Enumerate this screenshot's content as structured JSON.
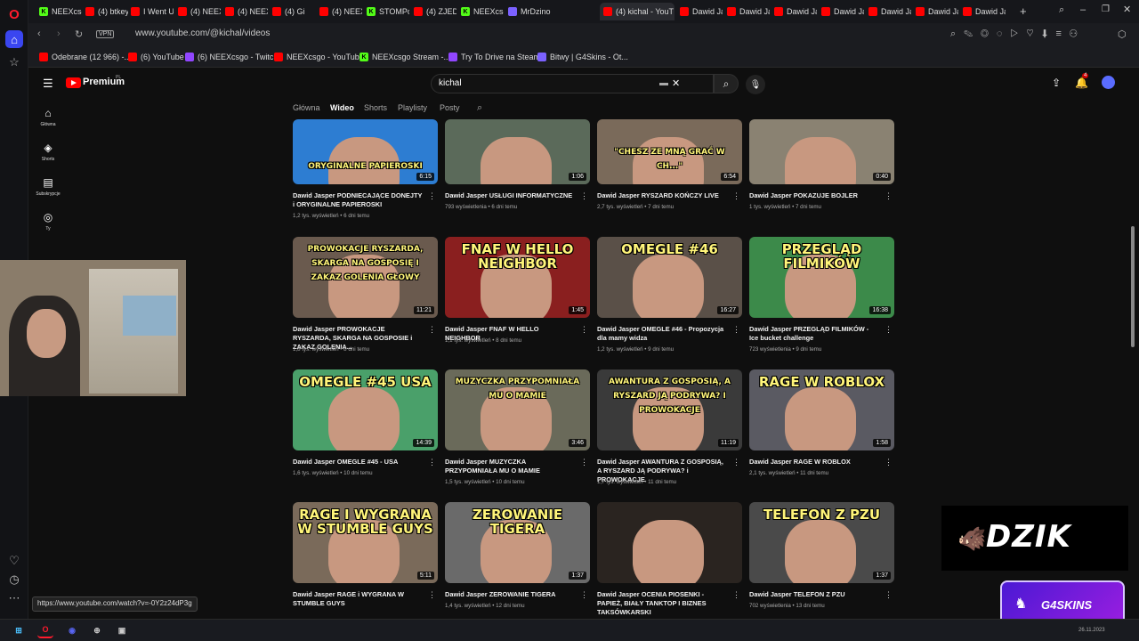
{
  "browser": {
    "tabs": [
      {
        "label": "NEEXcsgo",
        "fav": "k"
      },
      {
        "label": "(4) btkey",
        "fav": "yt"
      },
      {
        "label": "I Went U",
        "fav": "yt"
      },
      {
        "label": "(4) NEEX",
        "fav": "yt"
      },
      {
        "label": "(4) NEEX",
        "fav": "yt"
      },
      {
        "label": "(4) Gi",
        "fav": "yt"
      },
      {
        "label": "(4) NEEX",
        "fav": "yt"
      },
      {
        "label": "STOMPcs",
        "fav": "k"
      },
      {
        "label": "(4) ZJEDL",
        "fav": "yt"
      },
      {
        "label": "NEEXcsgo",
        "fav": "k"
      },
      {
        "label": "MrDzinol",
        "fav": "ms"
      },
      {
        "label": "(4) kichal - YouT",
        "fav": "yt"
      },
      {
        "label": "Dawid Ja",
        "fav": "yt"
      },
      {
        "label": "Dawid Ja",
        "fav": "yt"
      },
      {
        "label": "Dawid Ja",
        "fav": "yt"
      },
      {
        "label": "Dawid Ja",
        "fav": "yt"
      },
      {
        "label": "Dawid Ja",
        "fav": "yt"
      },
      {
        "label": "Dawid Ja",
        "fav": "yt"
      },
      {
        "label": "Dawid Ja",
        "fav": "yt"
      }
    ],
    "vpn_label": "VPN",
    "url": "www.youtube.com/@kichal/videos",
    "bookmarks": [
      {
        "label": "Odebrane (12 966) -...",
        "fav": "yt"
      },
      {
        "label": "(6) YouTube",
        "fav": "yt"
      },
      {
        "label": "(6) NEEXcsgo - Twitch",
        "fav": "tw"
      },
      {
        "label": "NEEXcsgo - YouTube",
        "fav": "yt"
      },
      {
        "label": "NEEXcsgo Stream -...",
        "fav": "k"
      },
      {
        "label": "Try To Drive na Steam",
        "fav": "tw"
      },
      {
        "label": "Bitwy | G4Skins - Ot...",
        "fav": "ms"
      }
    ]
  },
  "youtube": {
    "logo": "Premium",
    "logo_region": "PL",
    "search_value": "kichal",
    "notif_count": "4",
    "guide": [
      {
        "label": "Główna",
        "icon": "home-icon"
      },
      {
        "label": "Shorts",
        "icon": "shorts-icon"
      },
      {
        "label": "Subskrypcje",
        "icon": "subscriptions-icon"
      },
      {
        "label": "Ty",
        "icon": "you-icon"
      }
    ],
    "channel_tabs": [
      "Główna",
      "Wideo",
      "Shorts",
      "Playlisty",
      "Posty"
    ],
    "videos": [
      {
        "thumb_text": "ORYGINALNE PAPIEROSKI",
        "title": "Dawid Jasper PODNIECAJĄCE DONEJTY i ORYGINALNE PAPIEROSKI",
        "meta": "1,2 tys. wyświetleń • 6 dni temu",
        "duration": "6:15",
        "bg": "#2d7dd2"
      },
      {
        "thumb_text": "",
        "title": "Dawid Jasper USŁUGI INFORMATYCZNE",
        "meta": "793 wyświetlenia • 6 dni temu",
        "duration": "1:06",
        "bg": "#5b6a5a"
      },
      {
        "thumb_text": "\"CHESZ ZE MNĄ GRAĆ W CH...\"",
        "title": "Dawid Jasper RYSZARD KOŃCZY LIVE",
        "meta": "2,7 tys. wyświetleń • 7 dni temu",
        "duration": "6:54",
        "bg": "#7a6a5a"
      },
      {
        "thumb_text": "",
        "title": "Dawid Jasper POKAZUJE BOJLER",
        "meta": "1 tys. wyświetleń • 7 dni temu",
        "duration": "0:40",
        "bg": "#8a8272"
      },
      {
        "thumb_text": "PROWOKACJE RYSZARDA, SKARGA NA GOSPOSIĘ I ZAKAZ GOLENIA GŁOWY",
        "title": "Dawid Jasper PROWOKACJE RYSZARDA, SKARGA NA GOSPOSIE i ZAKAZ GOLENIA...",
        "meta": "1,8 tys. wyświetleń • 8 dni temu",
        "duration": "11:21",
        "bg": "#6a5a4e"
      },
      {
        "thumb_text": "FNAF W HELLO NEIGHBOR",
        "title": "Dawid Jasper FNAF W HELLO NEIGHBOR",
        "meta": "1,1 tys. wyświetleń • 8 dni temu",
        "duration": "1:45",
        "bg": "#8a1f1f"
      },
      {
        "thumb_text": "OMEGLE #46",
        "title": "Dawid Jasper OMEGLE #46 - Propozycja dla mamy widza",
        "meta": "1,2 tys. wyświetleń • 9 dni temu",
        "duration": "16:27",
        "bg": "#5a5048"
      },
      {
        "thumb_text": "PRZEGLĄD FILMIKÓW",
        "title": "Dawid Jasper PRZEGLĄD FILMIKÓW - Ice bucket challenge",
        "meta": "723 wyświetlenia • 9 dni temu",
        "duration": "16:38",
        "bg": "#3c8a4a"
      },
      {
        "thumb_text": "OMEGLE #45 USA",
        "title": "Dawid Jasper OMEGLE #45 - USA",
        "meta": "1,6 tys. wyświetleń • 10 dni temu",
        "duration": "14:39",
        "bg": "#4aa06a"
      },
      {
        "thumb_text": "MUZYCZKA PRZYPOMNIAŁA MU O MAMIE",
        "title": "Dawid Jasper MUZYCZKA PRZYPOMNIAŁA MU O MAMIE",
        "meta": "1,5 tys. wyświetleń • 10 dni temu",
        "duration": "3:46",
        "bg": "#6a6a5a"
      },
      {
        "thumb_text": "AWANTURA Z GOSPOSIĄ, A RYSZARD JĄ PODRYWA? I PROWOKACJE",
        "title": "Dawid Jasper AWANTURA Z GOSPOSIĄ, A RYSZARD JĄ PODRYWA? i PROWOKACJE",
        "meta": "1,7 tys. wyświetleń • 11 dni temu",
        "duration": "11:19",
        "bg": "#3a3a3a"
      },
      {
        "thumb_text": "RAGE W ROBLOX",
        "title": "Dawid Jasper RAGE W ROBLOX",
        "meta": "2,1 tys. wyświetleń • 11 dni temu",
        "duration": "1:58",
        "bg": "#5a5a62"
      },
      {
        "thumb_text": "RAGE I WYGRANA W STUMBLE GUYS",
        "title": "Dawid Jasper RAGE i WYGRANA W STUMBLE GUYS",
        "meta": "",
        "duration": "5:11",
        "bg": "#7a6a5a"
      },
      {
        "thumb_text": "ZEROWANIE TIGERA",
        "title": "Dawid Jasper ZEROWANIE TIGERA",
        "meta": "1,4 tys. wyświetleń • 12 dni temu",
        "duration": "1:37",
        "bg": "#6a6a6a"
      },
      {
        "thumb_text": "",
        "title": "Dawid Jasper OCENIA PIOSENKI - PAPIEŻ, BIAŁY TANKTOP I BIZNES TAKSÓWKARSKI",
        "meta": "",
        "duration": "",
        "bg": "#2a2420"
      },
      {
        "thumb_text": "TELEFON Z PZU",
        "title": "Dawid Jasper TELEFON Z PZU",
        "meta": "702 wyświetlenia • 13 dni temu",
        "duration": "1:37",
        "bg": "#4a4a4a"
      }
    ]
  },
  "overlays": {
    "status_url": "https://www.youtube.com/watch?v=-0Y2z24dP3g",
    "sponsor_1": "DZIK",
    "sponsor_2": "G4SKINS",
    "taskbar_date": "26.11.2023"
  },
  "colors": {
    "bg": "#0f0f0f",
    "yt_red": "#ff0000",
    "thumb_text": "#fff57a"
  }
}
